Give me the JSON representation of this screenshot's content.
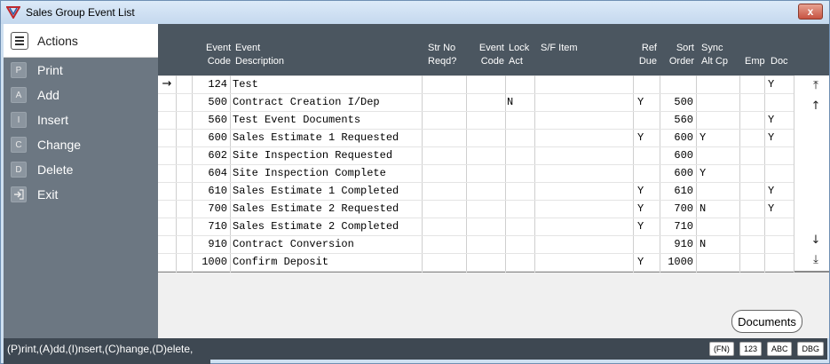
{
  "window": {
    "title": "Sales Group Event List",
    "close_label": "x"
  },
  "sidebar": {
    "header": "Actions",
    "items": [
      {
        "key": "P",
        "label": "Print"
      },
      {
        "key": "A",
        "label": "Add"
      },
      {
        "key": "I",
        "label": "Insert"
      },
      {
        "key": "C",
        "label": "Change"
      },
      {
        "key": "D",
        "label": "Delete"
      },
      {
        "key": "",
        "label": "Exit"
      }
    ]
  },
  "grid": {
    "headers": {
      "event_code": [
        "Event",
        "Code"
      ],
      "event_desc": [
        "Event",
        "Description"
      ],
      "str_no": [
        "Str No",
        "Reqd?"
      ],
      "event_code2": [
        "Event",
        "Code"
      ],
      "lock_act": [
        "Lock",
        "Act"
      ],
      "sf_item": [
        "S/F Item",
        ""
      ],
      "ref_due": [
        "Ref",
        "Due"
      ],
      "sort_order": [
        "Sort",
        "Order"
      ],
      "sync_alt": [
        "Sync",
        "Alt Cp"
      ],
      "emp": [
        "Emp",
        ""
      ],
      "doc": [
        "Doc",
        ""
      ]
    },
    "rows": [
      {
        "code": "124",
        "desc": "Test",
        "lock": "",
        "ref_due": "",
        "sort": "",
        "sync": "",
        "doc": "Y"
      },
      {
        "code": "500",
        "desc": "Contract Creation I/Dep",
        "lock": "N",
        "ref_due": "Y",
        "sort": "500",
        "sync": "",
        "doc": ""
      },
      {
        "code": "560",
        "desc": "Test Event Documents",
        "lock": "",
        "ref_due": "",
        "sort": "560",
        "sync": "",
        "doc": "Y"
      },
      {
        "code": "600",
        "desc": "Sales Estimate 1 Requested",
        "lock": "",
        "ref_due": "Y",
        "sort": "600",
        "sync": "Y",
        "doc": "Y"
      },
      {
        "code": "602",
        "desc": "Site Inspection Requested",
        "lock": "",
        "ref_due": "",
        "sort": "600",
        "sync": "",
        "doc": ""
      },
      {
        "code": "604",
        "desc": "Site Inspection Complete",
        "lock": "",
        "ref_due": "",
        "sort": "600",
        "sync": "Y",
        "doc": ""
      },
      {
        "code": "610",
        "desc": "Sales Estimate 1 Completed",
        "lock": "",
        "ref_due": "Y",
        "sort": "610",
        "sync": "",
        "doc": "Y"
      },
      {
        "code": "700",
        "desc": "Sales Estimate 2 Requested",
        "lock": "",
        "ref_due": "Y",
        "sort": "700",
        "sync": "N",
        "doc": "Y"
      },
      {
        "code": "710",
        "desc": "Sales Estimate 2 Completed",
        "lock": "",
        "ref_due": "Y",
        "sort": "710",
        "sync": "",
        "doc": ""
      },
      {
        "code": "910",
        "desc": "Contract Conversion",
        "lock": "",
        "ref_due": "",
        "sort": "910",
        "sync": "N",
        "doc": ""
      },
      {
        "code": "1000",
        "desc": "Confirm Deposit",
        "lock": "",
        "ref_due": "Y",
        "sort": "1000",
        "sync": "",
        "doc": ""
      }
    ],
    "row_pointer": "→",
    "scroll": {
      "top": "⤒",
      "up": "↑",
      "down": "↓",
      "bottom": "⤓"
    }
  },
  "documents_button": "Documents",
  "statusbar": {
    "text": "(P)rint,(A)dd,(I)nsert,(C)hange,(D)elete,",
    "badges": [
      "(FN)",
      "123",
      "ABC",
      "DBG"
    ]
  }
}
